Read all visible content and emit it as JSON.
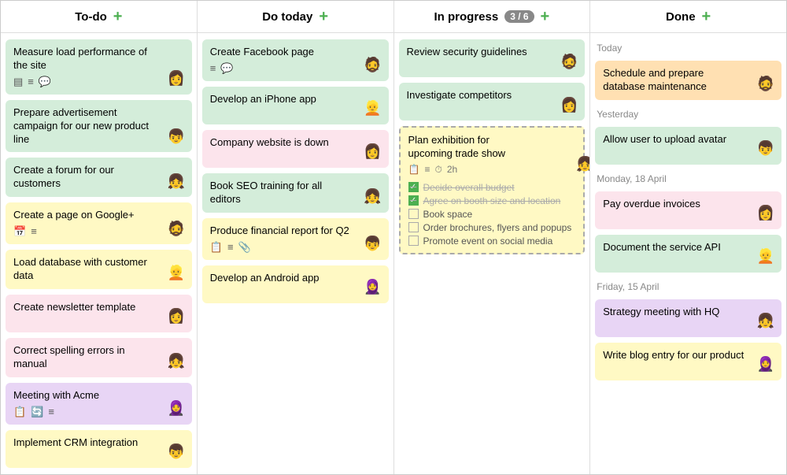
{
  "columns": [
    {
      "id": "todo",
      "title": "To-do",
      "badge": null,
      "cards": [
        {
          "id": "td1",
          "text": "Measure load performance of the site",
          "color": "green",
          "icons": [
            "📋",
            "☰",
            "💬"
          ],
          "avatar": "av1"
        },
        {
          "id": "td2",
          "text": "Prepare advertisement campaign for our new product line",
          "color": "green",
          "icons": [],
          "avatar": "av2"
        },
        {
          "id": "td3",
          "text": "Create a forum for our customers",
          "color": "green",
          "icons": [],
          "avatar": "av3"
        },
        {
          "id": "td4",
          "text": "Create a page on Google+",
          "color": "yellow",
          "icons": [
            "📅",
            "☰"
          ],
          "avatar": "av4"
        },
        {
          "id": "td5",
          "text": "Load database with customer data",
          "color": "yellow",
          "icons": [],
          "avatar": "av5"
        },
        {
          "id": "td6",
          "text": "Create newsletter template",
          "color": "pink",
          "icons": [],
          "avatar": "av1"
        },
        {
          "id": "td7",
          "text": "Correct spelling errors in manual",
          "color": "pink",
          "icons": [],
          "avatar": "av3"
        },
        {
          "id": "td8",
          "text": "Meeting with Acme",
          "color": "purple",
          "icons": [
            "📋",
            "🔄",
            "☰"
          ],
          "avatar": "av6"
        },
        {
          "id": "td9",
          "text": "Implement CRM integration",
          "color": "yellow",
          "icons": [],
          "avatar": "av2"
        }
      ]
    },
    {
      "id": "dotoday",
      "title": "Do today",
      "badge": null,
      "cards": [
        {
          "id": "dt1",
          "text": "Create Facebook page",
          "color": "green",
          "icons": [
            "☰",
            "💬"
          ],
          "avatar": "av4"
        },
        {
          "id": "dt2",
          "text": "Develop an iPhone app",
          "color": "green",
          "icons": [],
          "avatar": "av5"
        },
        {
          "id": "dt3",
          "text": "Company website is down",
          "color": "pink",
          "icons": [],
          "avatar": "av1"
        },
        {
          "id": "dt4",
          "text": "Book SEO training for all editors",
          "color": "green",
          "icons": [],
          "avatar": "av3"
        },
        {
          "id": "dt5",
          "text": "Produce financial report for Q2",
          "color": "yellow",
          "icons": [
            "📋",
            "☰",
            "📎"
          ],
          "avatar": "av2"
        },
        {
          "id": "dt6",
          "text": "Develop an Android app",
          "color": "yellow",
          "icons": [],
          "avatar": "av6"
        }
      ]
    },
    {
      "id": "inprogress",
      "title": "In progress",
      "badge": "3 / 6",
      "cards": [
        {
          "id": "ip1",
          "text": "Review security guidelines",
          "color": "green",
          "icons": [],
          "avatar": "av4"
        },
        {
          "id": "ip2",
          "text": "Investigate competitors",
          "color": "green",
          "icons": [],
          "avatar": "av1"
        },
        {
          "id": "ip3",
          "text": "Plan exhibition for upcoming trade show",
          "color": "yellow-dashed",
          "meta": [
            "📋",
            "☰",
            "⏱ 2h"
          ],
          "avatar": "av3",
          "subtasks": [
            {
              "text": "Decide overall budget",
              "done": true
            },
            {
              "text": "Agree on booth size and location",
              "done": true
            },
            {
              "text": "Book space",
              "done": false
            },
            {
              "text": "Order brochures, flyers and popups",
              "done": false
            },
            {
              "text": "Promote event on social media",
              "done": false
            }
          ]
        }
      ]
    },
    {
      "id": "done",
      "title": "Done",
      "badge": null,
      "sections": [
        {
          "label": "Today",
          "cards": [
            {
              "id": "d1",
              "text": "Schedule and prepare database maintenance",
              "color": "orange",
              "avatar": "av4"
            }
          ]
        },
        {
          "label": "Yesterday",
          "cards": [
            {
              "id": "d2",
              "text": "Allow user to upload avatar",
              "color": "green",
              "avatar": "av2"
            }
          ]
        },
        {
          "label": "Monday, 18 April",
          "cards": [
            {
              "id": "d3",
              "text": "Pay overdue invoices",
              "color": "pink",
              "avatar": "av1"
            },
            {
              "id": "d4",
              "text": "Document the service API",
              "color": "green",
              "avatar": "av5"
            }
          ]
        },
        {
          "label": "Friday, 15 April",
          "cards": [
            {
              "id": "d5",
              "text": "Strategy meeting with HQ",
              "color": "purple",
              "avatar": "av3"
            },
            {
              "id": "d6",
              "text": "Write blog entry for our product",
              "color": "yellow",
              "avatar": "av6"
            }
          ]
        }
      ]
    }
  ],
  "add_label": "+"
}
